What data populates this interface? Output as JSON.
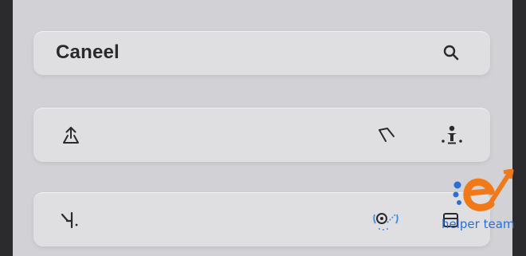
{
  "search": {
    "label": "Caneel",
    "icon": "search-icon"
  },
  "row2": {
    "left_icon": "share-upload-icon",
    "right_icons": [
      "corner-arrow-icon",
      "person-pin-icon"
    ]
  },
  "row3": {
    "left_icon": "split-text-icon",
    "right_icons": [
      "animation-bounce-icon",
      "window-card-icon"
    ]
  },
  "watermark": {
    "text": "helper team",
    "brand_colors": [
      "#f07a1a",
      "#2a6fd6"
    ]
  }
}
